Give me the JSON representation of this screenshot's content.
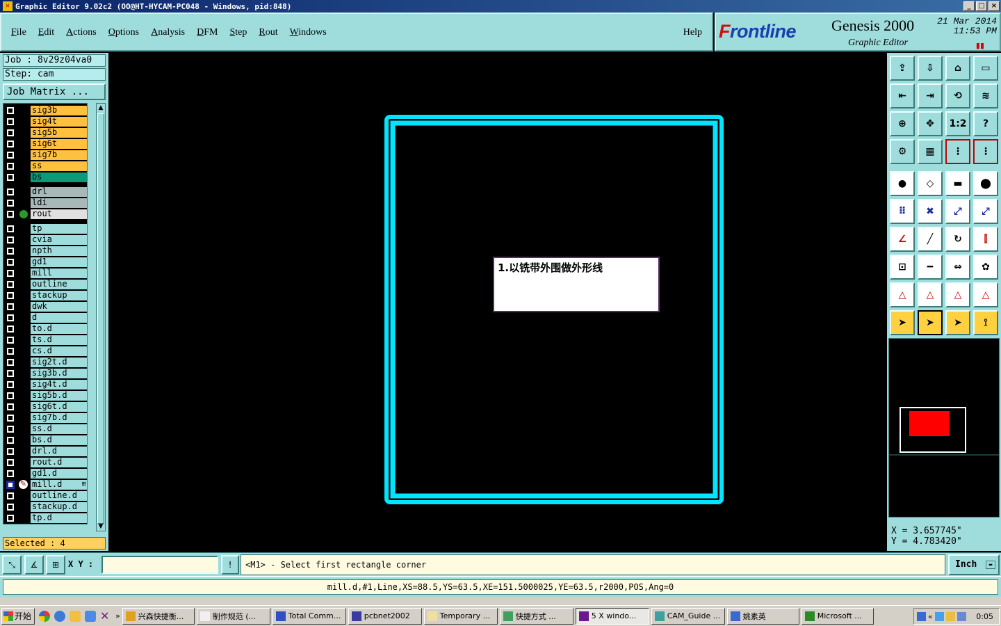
{
  "window": {
    "title": "Graphic Editor 9.02c2 (OO@HT-HYCAM-PC048 - Windows, pid:848)"
  },
  "menu": {
    "items": [
      "File",
      "Edit",
      "Actions",
      "Options",
      "Analysis",
      "DFM",
      "Step",
      "Rout",
      "Windows"
    ],
    "help": "Help"
  },
  "brand": {
    "logo_prefix": "F",
    "logo_rest": "rontline",
    "product": "Genesis 2000",
    "subtitle": "Graphic Editor",
    "date": "21 Mar 2014",
    "time": "11:53 PM",
    "pause_icon": "pause-icon"
  },
  "job": {
    "job_label": "Job : 8v29z04va0",
    "step_label": "Step: cam",
    "job_matrix_button": "Job Matrix ..."
  },
  "layers": [
    {
      "name": "sig3b",
      "color": "#ffc040",
      "group": 0
    },
    {
      "name": "sig4t",
      "color": "#ffc040",
      "group": 0
    },
    {
      "name": "sig5b",
      "color": "#ffc040",
      "group": 0
    },
    {
      "name": "sig6t",
      "color": "#ffc040",
      "group": 0
    },
    {
      "name": "sig7b",
      "color": "#ffc040",
      "group": 0
    },
    {
      "name": "ss",
      "color": "#ffc040",
      "group": 0
    },
    {
      "name": "bs",
      "color": "#0a9a78",
      "group": 0
    },
    {
      "name": "drl",
      "color": "#a8b8b8",
      "group": 1
    },
    {
      "name": "ldi",
      "color": "#a8b8b8",
      "group": 1
    },
    {
      "name": "rout",
      "color": "#e0e0e0",
      "group": 1,
      "work": true
    },
    {
      "name": "tp",
      "color": "#9fdcdc",
      "group": 2
    },
    {
      "name": "cvia",
      "color": "#9fdcdc",
      "group": 2
    },
    {
      "name": "npth",
      "color": "#9fdcdc",
      "group": 2
    },
    {
      "name": "gd1",
      "color": "#9fdcdc",
      "group": 2
    },
    {
      "name": "mill",
      "color": "#9fdcdc",
      "group": 2
    },
    {
      "name": "outline",
      "color": "#9fdcdc",
      "group": 2
    },
    {
      "name": "stackup",
      "color": "#9fdcdc",
      "group": 2
    },
    {
      "name": "dwk",
      "color": "#9fdcdc",
      "group": 2
    },
    {
      "name": "d",
      "color": "#9fdcdc",
      "group": 2
    },
    {
      "name": "to.d",
      "color": "#9fdcdc",
      "group": 2
    },
    {
      "name": "ts.d",
      "color": "#9fdcdc",
      "group": 2
    },
    {
      "name": "cs.d",
      "color": "#9fdcdc",
      "group": 2
    },
    {
      "name": "sig2t.d",
      "color": "#9fdcdc",
      "group": 2
    },
    {
      "name": "sig3b.d",
      "color": "#9fdcdc",
      "group": 2
    },
    {
      "name": "sig4t.d",
      "color": "#9fdcdc",
      "group": 2
    },
    {
      "name": "sig5b.d",
      "color": "#9fdcdc",
      "group": 2
    },
    {
      "name": "sig6t.d",
      "color": "#9fdcdc",
      "group": 2
    },
    {
      "name": "sig7b.d",
      "color": "#9fdcdc",
      "group": 2
    },
    {
      "name": "ss.d",
      "color": "#9fdcdc",
      "group": 2
    },
    {
      "name": "bs.d",
      "color": "#9fdcdc",
      "group": 2
    },
    {
      "name": "drl.d",
      "color": "#9fdcdc",
      "group": 2
    },
    {
      "name": "rout.d",
      "color": "#9fdcdc",
      "group": 2
    },
    {
      "name": "gd1.d",
      "color": "#9fdcdc",
      "group": 2
    },
    {
      "name": "mill.d",
      "color": "#9fdcdc",
      "group": 2,
      "selected": true
    },
    {
      "name": "outline.d",
      "color": "#9fdcdc",
      "group": 2
    },
    {
      "name": "stackup.d",
      "color": "#9fdcdc",
      "group": 2
    },
    {
      "name": "tp.d",
      "color": "#9fdcdc",
      "group": 2
    }
  ],
  "selected_count": "Selected : 4",
  "canvas": {
    "board_color": "#00e5ff",
    "note_text": "1.以铣带外围做外形线"
  },
  "toolbar_icons": [
    "snapshot-icon",
    "home-layer-icon",
    "home-icon",
    "window-icon",
    "prev-icon",
    "next-icon",
    "undo-zoom-icon",
    "redraw-icon",
    "zoom-fit-icon",
    "zoom-profile-icon",
    "zoom-ratio-icon",
    "help-icon",
    "tools-icon",
    "grid-icon",
    "layer-compare-icon",
    "layer-diff-icon",
    "pad-icon",
    "rotate-box-icon",
    "ruler-icon",
    "round-pad-icon",
    "connect-icon",
    "delete-icon",
    "move-point-icon",
    "add-point-icon",
    "angle-icon",
    "line-icon",
    "arc-icon",
    "mirror-icon",
    "features-icon",
    "minus-icon",
    "measure-icon",
    "shapes-icon",
    "triangle-a-icon",
    "triangle-b-icon",
    "triangle-c-icon",
    "triangle-d-icon",
    "select-icon",
    "select-active-icon",
    "select-box-icon",
    "route-icon"
  ],
  "zoom_ratio_label": "1:2",
  "coords": {
    "x": "X = 3.657745\"",
    "y": "Y = 4.783420\""
  },
  "command": {
    "xy_label": "X Y :",
    "xy_value": "",
    "prompt": "<M1> - Select first rectangle corner",
    "unit": "Inch"
  },
  "feature_info": "mill.d,#1,Line,XS=88.5,YS=63.5,XE=151.5000025,YE=63.5,r2000,POS,Ang=0",
  "taskbar": {
    "start": "开始",
    "tasks": [
      "兴森快捷衡...",
      "制作规范 (...",
      "Total Comm...",
      "pcbnet2002",
      "Temporary ...",
      "快捷方式 ...",
      "5 X windo...",
      "CAM_Guide ...",
      "姚素英",
      "Microsoft ..."
    ],
    "clock": "0:05"
  }
}
